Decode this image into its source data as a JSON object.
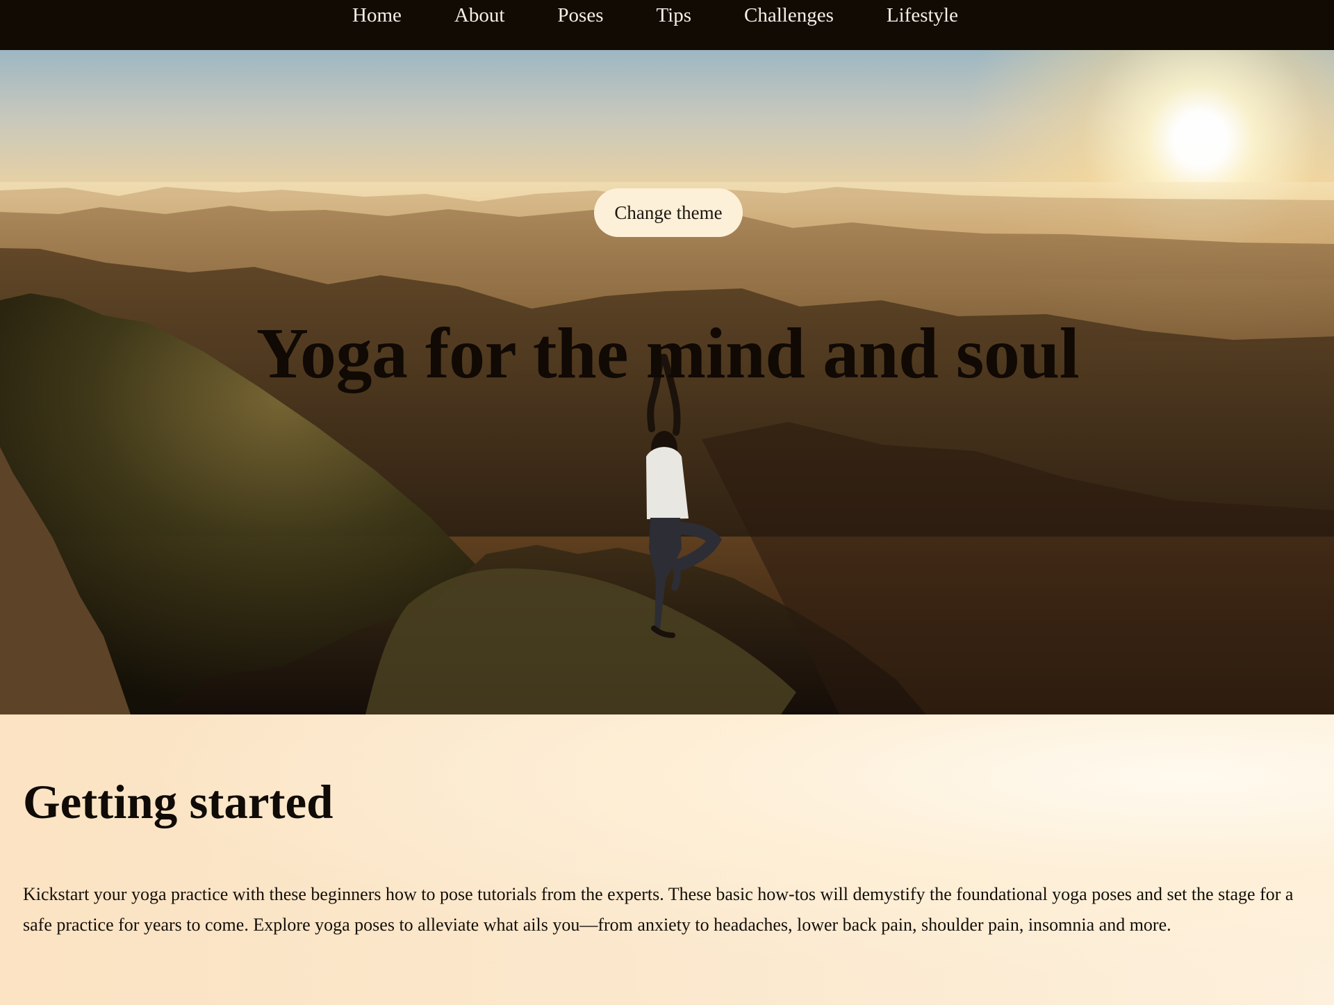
{
  "navigation": {
    "items": [
      "Home",
      "About",
      "Poses",
      "Tips",
      "Challenges",
      "Lifestyle"
    ]
  },
  "hero": {
    "button_label": "Change theme",
    "title": "Yoga for the mind and soul"
  },
  "content": {
    "heading": "Getting started",
    "body": "Kickstart your yoga practice with these beginners how to pose tutorials from the experts. These basic how-tos will demystify the foundational yoga poses and set the stage for a safe practice for years to come. Explore yoga poses to alleviate what ails you—from anxiety to headaches, lower back pain, shoulder pain, insomnia and more."
  },
  "colors": {
    "nav_background": "#120b04",
    "button_background": "#fdf0d8",
    "page_background": "#fbe8cb"
  }
}
